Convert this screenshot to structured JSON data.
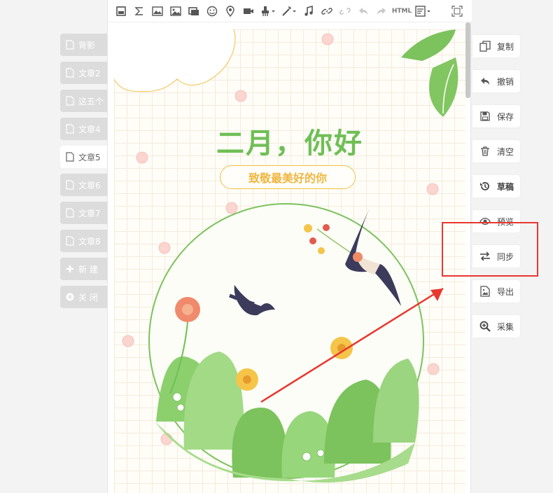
{
  "left_tabs": [
    {
      "label": "背影",
      "active": false
    },
    {
      "label": "文章2",
      "active": false
    },
    {
      "label": "这五个",
      "active": false
    },
    {
      "label": "文章4",
      "active": false
    },
    {
      "label": "文章5",
      "active": true
    },
    {
      "label": "文章6",
      "active": false
    },
    {
      "label": "文章7",
      "active": false
    },
    {
      "label": "文章8",
      "active": false
    },
    {
      "label": "新 建",
      "active": false,
      "icon": "plus-icon"
    },
    {
      "label": "关 闭",
      "active": false,
      "icon": "close-icon"
    }
  ],
  "toolbar": {
    "html_label": "HTML",
    "buttons": [
      "wechat-icon",
      "sigma-icon",
      "image-icon",
      "image-gallery-icon",
      "slides-icon",
      "emoji-icon",
      "location-icon",
      "video-icon",
      "format-brush-icon",
      "magic-wand-icon",
      "music-icon",
      "link-icon",
      "unlink-icon",
      "undo-icon",
      "redo-icon",
      "html-icon",
      "template-icon",
      "fullscreen-icon"
    ]
  },
  "poster": {
    "headline": "二月，你好",
    "subtitle": "致敬最美好的你"
  },
  "actions": [
    {
      "label": "复制",
      "icon": "copy-icon",
      "bold": false
    },
    {
      "label": "撤销",
      "icon": "undo-icon",
      "bold": false
    },
    {
      "label": "保存",
      "icon": "save-icon",
      "bold": false
    },
    {
      "label": "清空",
      "icon": "trash-icon",
      "bold": false
    },
    {
      "label": "草稿",
      "icon": "history-icon",
      "bold": true
    },
    {
      "label": "预览",
      "icon": "eye-icon",
      "bold": false
    },
    {
      "label": "同步",
      "icon": "sync-icon",
      "bold": false
    },
    {
      "label": "导出",
      "icon": "export-image-icon",
      "bold": false
    },
    {
      "label": "采集",
      "icon": "zoom-search-icon",
      "bold": false
    }
  ],
  "colors": {
    "accent_green": "#6fbf56",
    "accent_yellow": "#f0b640",
    "highlight_red": "#e8372f"
  }
}
